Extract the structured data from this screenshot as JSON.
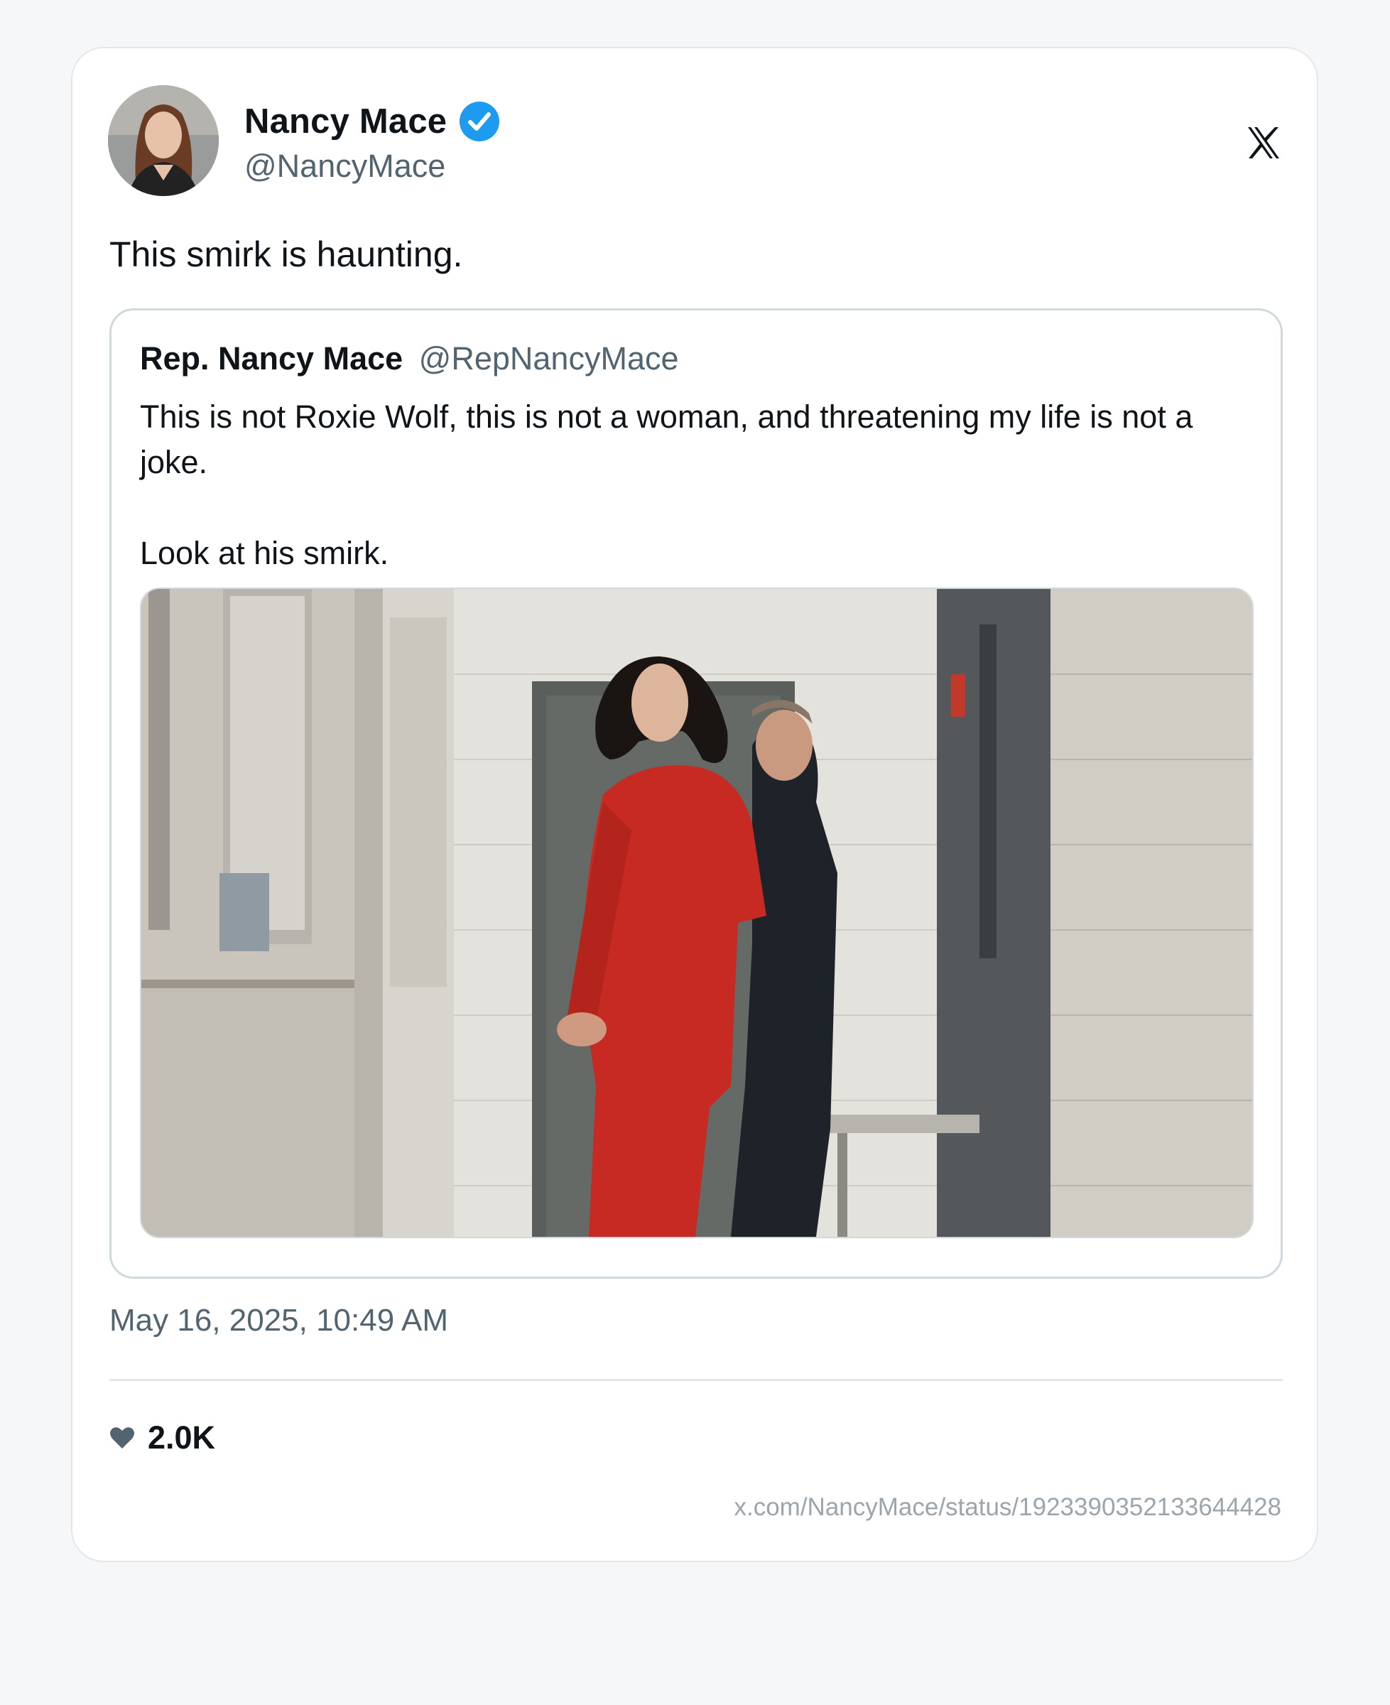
{
  "author": {
    "name": "Nancy Mace",
    "handle": "@NancyMace",
    "avatar_icon": "profile-photo",
    "verified_icon": "verified-badge-icon",
    "verified_color": "#1d9bf0"
  },
  "platform_icon": "x-logo-icon",
  "tweet": {
    "text": "This smirk is haunting."
  },
  "quoted": {
    "name": "Rep. Nancy Mace",
    "handle": "@RepNancyMace",
    "text": "This is not Roxie Wolf, this is not a woman, and threatening my life is not a joke.\n\nLook at his smirk.",
    "media_icon": "photo-jail-hallway"
  },
  "timestamp": "May 16, 2025, 10:49 AM",
  "likes": {
    "icon": "heart-icon",
    "count": "2.0K"
  },
  "url": "x.com/NancyMace/status/1923390352133644428"
}
